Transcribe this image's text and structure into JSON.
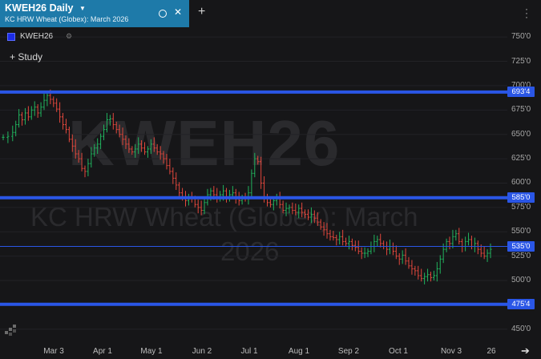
{
  "tab": {
    "title": "KWEH26 Daily",
    "subtitle": "KC HRW Wheat (Globex): March 2026",
    "new_tab_label": "+"
  },
  "legend": {
    "symbol": "KWEH26"
  },
  "study_button": {
    "label": "+ Study"
  },
  "watermark": {
    "symbol": "KWEH26",
    "name_line1": "KC HRW Wheat (Globex): March",
    "name_line2": "2026"
  },
  "icons": [
    "caret-down-icon",
    "circle-icon",
    "close-icon",
    "plus-icon",
    "kebab-icon",
    "gear-icon",
    "logo-icon",
    "chevron-right-icon"
  ],
  "colors": {
    "tab_bg": "#1e7aa9",
    "up_bar": "#21b35e",
    "down_bar": "#e1473c",
    "level_line": "#2a56e6",
    "background": "#161618"
  },
  "chart_data": {
    "type": "ohlc",
    "title": "",
    "xlabel": "",
    "ylabel": "",
    "ylim": [
      437.5,
      760
    ],
    "y_ticks": [
      "750'0",
      "725'0",
      "700'0",
      "675'0",
      "650'0",
      "625'0",
      "600'0",
      "575'0",
      "550'0",
      "525'0",
      "500'0",
      "450'0"
    ],
    "x_ticks": [
      "Mar 3",
      "Apr 1",
      "May 1",
      "Jun 2",
      "Jul 1",
      "Aug 1",
      "Sep 2",
      "Oct 1",
      "Nov 3",
      "26"
    ],
    "horizontal_levels": [
      {
        "label": "693'4",
        "value": 693.5,
        "style": "thick"
      },
      {
        "label": "585'0",
        "value": 585.0,
        "style": "thick"
      },
      {
        "label": "535'0",
        "value": 535.0,
        "style": "thin"
      },
      {
        "label": "475'4",
        "value": 475.5,
        "style": "thick"
      }
    ],
    "series": [
      {
        "values": [
          [
            0,
            647
          ],
          [
            3,
            648
          ],
          [
            6,
            652
          ],
          [
            8,
            660
          ],
          [
            10,
            670
          ],
          [
            12,
            665
          ],
          [
            14,
            672
          ],
          [
            16,
            668
          ],
          [
            18,
            675
          ],
          [
            20,
            678
          ],
          [
            22,
            672
          ],
          [
            24,
            678
          ],
          [
            26,
            685
          ],
          [
            28,
            690
          ],
          [
            30,
            686
          ],
          [
            32,
            682
          ],
          [
            34,
            676
          ],
          [
            36,
            668
          ],
          [
            38,
            660
          ],
          [
            40,
            655
          ],
          [
            42,
            645
          ],
          [
            44,
            638
          ],
          [
            46,
            630
          ],
          [
            48,
            625
          ],
          [
            50,
            615
          ],
          [
            52,
            612
          ],
          [
            54,
            620
          ],
          [
            56,
            630
          ],
          [
            58,
            636
          ],
          [
            60,
            640
          ],
          [
            62,
            648
          ],
          [
            64,
            655
          ],
          [
            66,
            665
          ],
          [
            68,
            666
          ],
          [
            70,
            660
          ],
          [
            72,
            655
          ],
          [
            74,
            650
          ],
          [
            76,
            645
          ],
          [
            78,
            640
          ],
          [
            80,
            635
          ],
          [
            82,
            632
          ],
          [
            84,
            635
          ],
          [
            86,
            640
          ],
          [
            88,
            636
          ],
          [
            90,
            632
          ],
          [
            92,
            635
          ],
          [
            94,
            640
          ],
          [
            96,
            636
          ],
          [
            98,
            632
          ],
          [
            100,
            630
          ],
          [
            102,
            625
          ],
          [
            104,
            618
          ],
          [
            106,
            612
          ],
          [
            108,
            605
          ],
          [
            110,
            598
          ],
          [
            112,
            590
          ],
          [
            114,
            585
          ],
          [
            116,
            582
          ],
          [
            118,
            585
          ],
          [
            120,
            584
          ],
          [
            122,
            578
          ],
          [
            124,
            575
          ],
          [
            126,
            572
          ],
          [
            128,
            580
          ],
          [
            130,
            588
          ],
          [
            132,
            592
          ],
          [
            134,
            588
          ],
          [
            136,
            584
          ],
          [
            138,
            588
          ],
          [
            140,
            592
          ],
          [
            142,
            585
          ],
          [
            144,
            588
          ],
          [
            146,
            590
          ],
          [
            148,
            585
          ],
          [
            150,
            582
          ],
          [
            152,
            585
          ],
          [
            154,
            584
          ],
          [
            156,
            590
          ],
          [
            158,
            610
          ],
          [
            160,
            625
          ],
          [
            162,
            622
          ],
          [
            164,
            600
          ],
          [
            166,
            585
          ],
          [
            168,
            580
          ],
          [
            170,
            578
          ],
          [
            172,
            582
          ],
          [
            174,
            584
          ],
          [
            176,
            578
          ],
          [
            178,
            572
          ],
          [
            180,
            574
          ],
          [
            182,
            575
          ],
          [
            184,
            572
          ],
          [
            186,
            570
          ],
          [
            188,
            574
          ],
          [
            190,
            570
          ],
          [
            192,
            568
          ],
          [
            194,
            565
          ],
          [
            196,
            568
          ],
          [
            198,
            564
          ],
          [
            200,
            560
          ],
          [
            202,
            555
          ],
          [
            204,
            552
          ],
          [
            206,
            548
          ],
          [
            208,
            545
          ],
          [
            210,
            544
          ],
          [
            212,
            542
          ],
          [
            214,
            545
          ],
          [
            216,
            540
          ],
          [
            218,
            538
          ],
          [
            220,
            540
          ],
          [
            222,
            536
          ],
          [
            224,
            534
          ],
          [
            226,
            530
          ],
          [
            228,
            528
          ],
          [
            230,
            528
          ],
          [
            232,
            530
          ],
          [
            234,
            535
          ],
          [
            236,
            540
          ],
          [
            238,
            542
          ],
          [
            240,
            538
          ],
          [
            242,
            535
          ],
          [
            244,
            532
          ],
          [
            246,
            535
          ],
          [
            248,
            530
          ],
          [
            250,
            525
          ],
          [
            252,
            522
          ],
          [
            254,
            526
          ],
          [
            256,
            520
          ],
          [
            258,
            515
          ],
          [
            260,
            512
          ],
          [
            262,
            510
          ],
          [
            264,
            505
          ],
          [
            266,
            502
          ],
          [
            268,
            504
          ],
          [
            270,
            506
          ],
          [
            272,
            503
          ],
          [
            274,
            505
          ],
          [
            276,
            512
          ],
          [
            278,
            522
          ],
          [
            280,
            532
          ],
          [
            282,
            540
          ],
          [
            284,
            538
          ],
          [
            286,
            545
          ],
          [
            288,
            548
          ],
          [
            290,
            540
          ],
          [
            292,
            535
          ],
          [
            294,
            540
          ],
          [
            296,
            542
          ],
          [
            298,
            535
          ],
          [
            300,
            538
          ],
          [
            302,
            532
          ],
          [
            304,
            528
          ],
          [
            306,
            525
          ],
          [
            308,
            528
          ],
          [
            310,
            532
          ]
        ]
      }
    ]
  }
}
